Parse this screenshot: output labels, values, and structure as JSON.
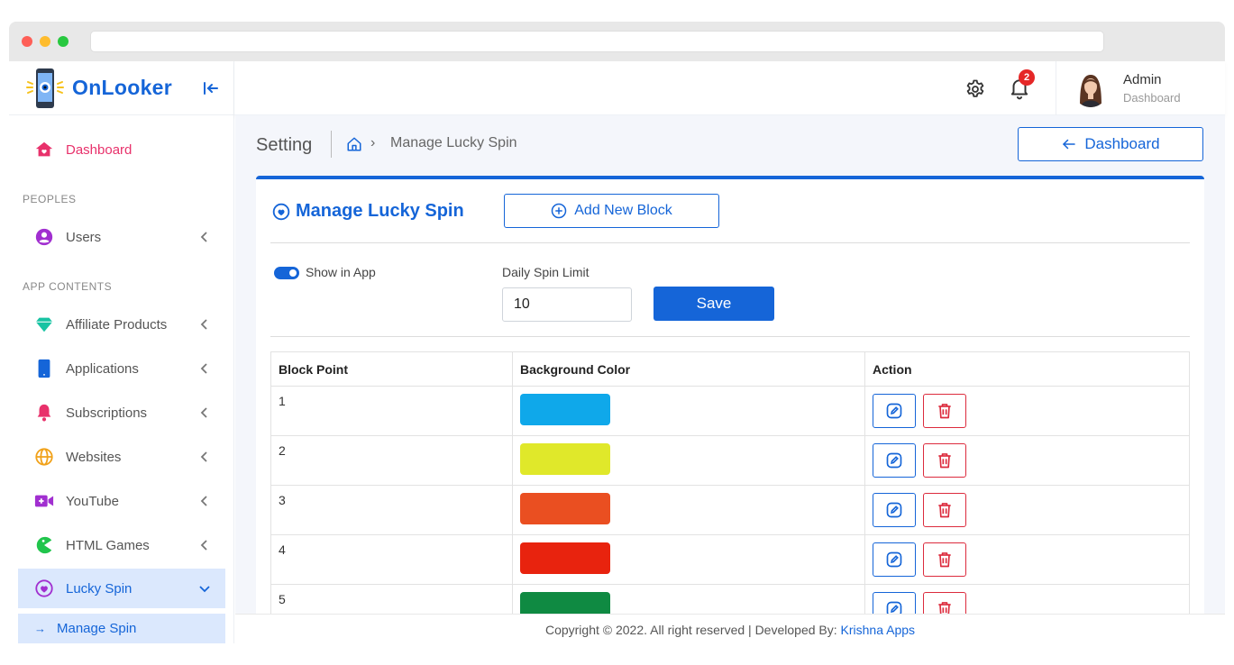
{
  "brand": {
    "name": "OnLooker"
  },
  "sidebar": {
    "dashboard": {
      "label": "Dashboard",
      "color": "#e8316b"
    },
    "sections": [
      {
        "title": "PEOPLES"
      },
      {
        "title": "APP CONTENTS"
      }
    ],
    "items": [
      {
        "label": "Users",
        "icon": "user-circle-icon",
        "color": "#a12fd0"
      },
      {
        "label": "Affiliate Products",
        "icon": "diamond-icon",
        "color": "#18c3a3"
      },
      {
        "label": "Applications",
        "icon": "smartphone-icon",
        "color": "#1565d8"
      },
      {
        "label": "Subscriptions",
        "icon": "bell-icon",
        "color": "#e8316b"
      },
      {
        "label": "Websites",
        "icon": "globe-icon",
        "color": "#f1a21b"
      },
      {
        "label": "YouTube",
        "icon": "video-icon",
        "color": "#a12fd0"
      },
      {
        "label": "HTML Games",
        "icon": "pacman-icon",
        "color": "#21c54c"
      },
      {
        "label": "Lucky Spin",
        "icon": "heart-circle-icon",
        "color": "#a12fd0",
        "active": true
      }
    ],
    "sub_item": {
      "label": "Manage Spin",
      "arrow": "→"
    }
  },
  "header": {
    "notification_count": "2",
    "profile": {
      "name": "Admin",
      "role": "Dashboard"
    }
  },
  "page": {
    "title": "Setting",
    "breadcrumb_sep": "›",
    "breadcrumb": "Manage Lucky Spin",
    "back_button": "Dashboard"
  },
  "card": {
    "title": "Manage Lucky Spin",
    "add_button": "Add New Block",
    "toggle_label": "Show in App",
    "toggle_on": true,
    "limit_label": "Daily Spin Limit",
    "limit_value": "10",
    "save_button": "Save"
  },
  "table": {
    "headers": [
      "Block Point",
      "Background Color",
      "Action"
    ],
    "rows": [
      {
        "point": "1",
        "color": "#0fa8ea"
      },
      {
        "point": "2",
        "color": "#e0e82a"
      },
      {
        "point": "3",
        "color": "#ea4f21"
      },
      {
        "point": "4",
        "color": "#e8230e"
      },
      {
        "point": "5",
        "color": "#0f8a42"
      }
    ]
  },
  "footer": {
    "text": "Copyright © 2022. All right reserved | Developed By: ",
    "link": "Krishna Apps"
  },
  "colors": {
    "primary": "#1565d8",
    "danger": "#dc2b3d",
    "content_bg": "#f4f6fb"
  }
}
